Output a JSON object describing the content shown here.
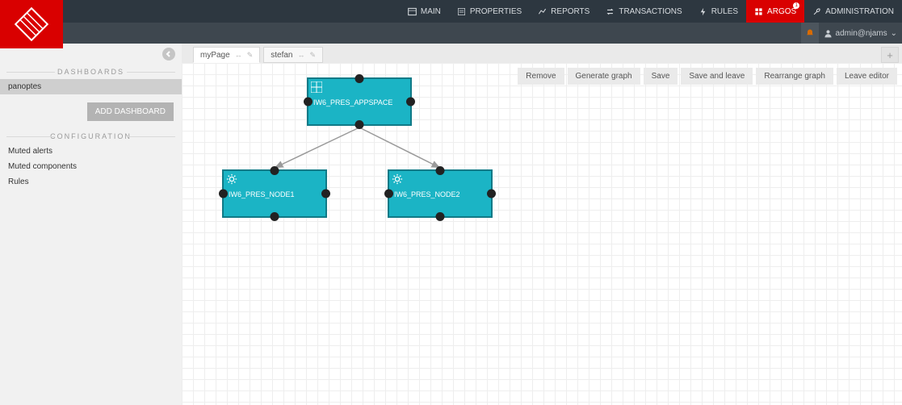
{
  "nav": {
    "main": "MAIN",
    "properties": "PROPERTIES",
    "reports": "REPORTS",
    "transactions": "TRANSACTIONS",
    "rules": "RULES",
    "argos": "ARGOS",
    "argos_badge": "1",
    "administration": "ADMINISTRATION"
  },
  "user": {
    "name": "admin@njams"
  },
  "sidebar": {
    "dashboards_title": "DASHBOARDS",
    "dashboards": [
      "panoptes"
    ],
    "add_dashboard": "ADD DASHBOARD",
    "config_title": "CONFIGURATION",
    "config_items": [
      "Muted alerts",
      "Muted components",
      "Rules"
    ]
  },
  "tabs": [
    {
      "label": "myPage",
      "active": true
    },
    {
      "label": "stefan",
      "active": false
    }
  ],
  "toolbar": {
    "remove": "Remove",
    "generate": "Generate graph",
    "save": "Save",
    "save_leave": "Save and leave",
    "rearrange": "Rearrange graph",
    "leave": "Leave editor"
  },
  "nodes": {
    "root": {
      "label": "IW6_PRES_APPSPACE"
    },
    "left": {
      "label": "IW6_PRES_NODE1"
    },
    "right": {
      "label": "IW6_PRES_NODE2"
    }
  }
}
